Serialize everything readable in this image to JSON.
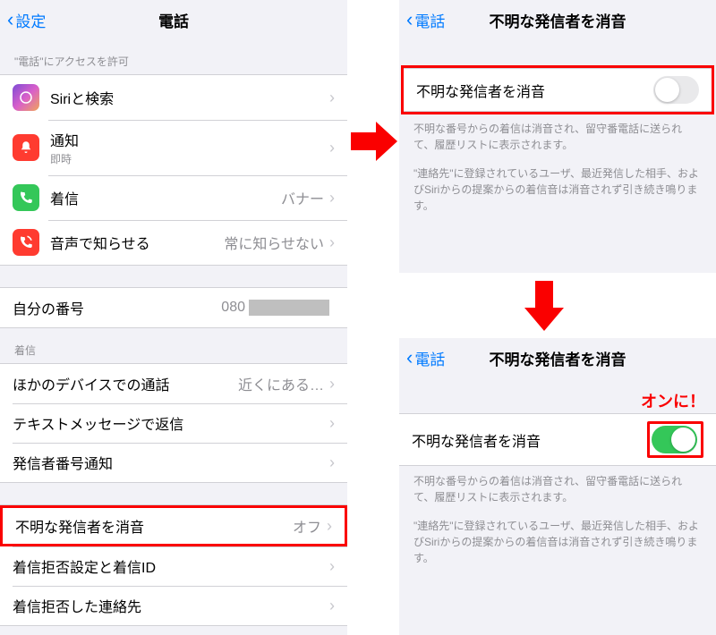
{
  "left": {
    "back": "設定",
    "title": "電話",
    "section1_header": "\"電話\"にアクセスを許可",
    "siri": "Siriと検索",
    "notif": "通知",
    "notif_sub": "即時",
    "incoming": "着信",
    "incoming_value": "バナー",
    "announce": "音声で知らせる",
    "announce_value": "常に知らせない",
    "my_number": "自分の番号",
    "my_number_prefix": "080",
    "section2_header": "着信",
    "other_devices": "ほかのデバイスでの通話",
    "other_devices_value": "近くにある…",
    "text_reply": "テキストメッセージで返信",
    "caller_id": "発信者番号通知",
    "silence": "不明な発信者を消音",
    "silence_value": "オフ",
    "block_settings": "着信拒否設定と着信ID",
    "blocked_contacts": "着信拒否した連絡先"
  },
  "detail": {
    "back": "電話",
    "title": "不明な発信者を消音",
    "row_label": "不明な発信者を消音",
    "footer1": "不明な番号からの着信は消音され、留守番電話に送られて、履歴リストに表示されます。",
    "footer2": "\"連絡先\"に登録されているユーザ、最近発信した相手、およびSiriからの提案からの着信音は消音されず引き続き鳴ります。"
  },
  "annotation": {
    "on_label": "オンに！"
  }
}
